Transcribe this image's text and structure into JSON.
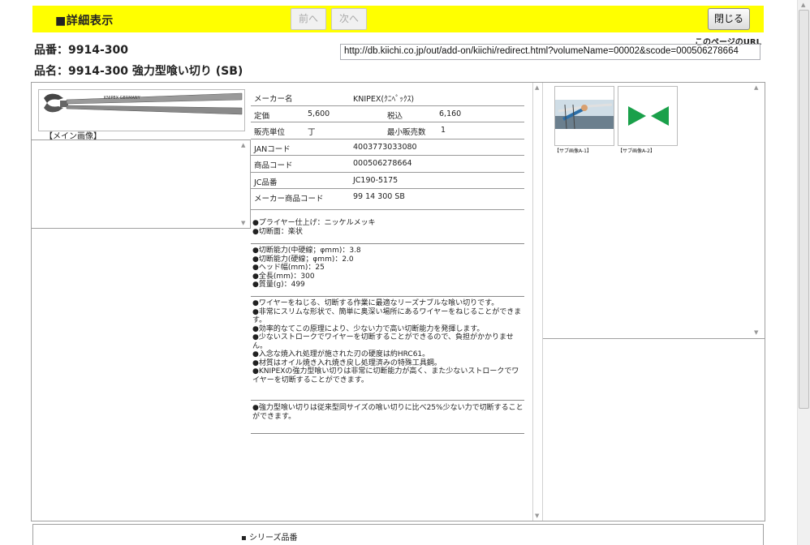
{
  "header": {
    "title": "■詳細表示",
    "prev_label": "前へ",
    "next_label": "次へ",
    "close_label": "閉じる"
  },
  "page_url": {
    "label": "このページのURL",
    "value": "http://db.kiichi.co.jp/out/add-on/kiichi/redirect.html?volumeName=00002&scode=000506278664"
  },
  "product": {
    "hinban_line": "品番：9914-300",
    "hinmei_line": "品名：9914-300 強力型喰い切り (SB)"
  },
  "main_image": {
    "caption": "【メイン画像】"
  },
  "spec": {
    "maker_label": "メーカー名",
    "maker_value": "KNIPEX(ｸﾆﾍﾟｯｸｽ)",
    "list_price_label": "定価",
    "list_price_value": "5,600",
    "tax_in_label": "税込",
    "tax_in_value": "6,160",
    "unit_label": "販売単位",
    "unit_value": "丁",
    "min_qty_label": "最小販売数",
    "min_qty_value": "1",
    "jan_label": "JANコード",
    "jan_value": "4003773033080",
    "code_label": "商品コード",
    "code_value": "000506278664",
    "jc_label": "JC品番",
    "jc_value": "JC190-5175",
    "maker_code_label": "メーカー商品コード",
    "maker_code_value": "99 14 300 SB"
  },
  "notes": {
    "b1": [
      "●プライヤー仕上げ：ニッケルメッキ",
      "●切断面：楽状"
    ],
    "b2": [
      "●切断能力(中硬線；φmm)：3.8",
      "●切断能力(硬線；φmm)：2.0",
      "●ヘッド幅(mm)：25",
      "●全長(mm)：300",
      "●質量(g)：499"
    ],
    "b3": [
      "●ワイヤーをねじる、切断する作業に最適なリーズナブルな喰い切りです。",
      "●非常にスリムな形状で、簡単に奥深い場所にあるワイヤーをねじることができます。",
      "●効率的なてこの原理により、少ない力で高い切断能力を発揮します。",
      "●少ないストロークでワイヤーを切断することができるので、負担がかかりません。",
      "●入念な焼入れ処理が施された刃の硬度は約HRC61。",
      "●材質はオイル焼き入れ焼き戻し処理済みの特殊工具鋼。",
      "●KNIPEXの強力型喰い切りは非常に切断能力が高く、また少ないストロークでワイヤーを切断することができます。"
    ],
    "b4": [
      "●強力型喰い切りは従来型同サイズの喰い切りに比べ25%少ない力で切断することができます。"
    ]
  },
  "sub_images": [
    {
      "caption": "【サブ画像A-1】"
    },
    {
      "caption": "【サブ画像A-2】"
    }
  ],
  "series": {
    "label": "シリーズ品番"
  },
  "colors": {
    "header_bg": "#ffff00",
    "accent_green": "#1aa04a"
  }
}
